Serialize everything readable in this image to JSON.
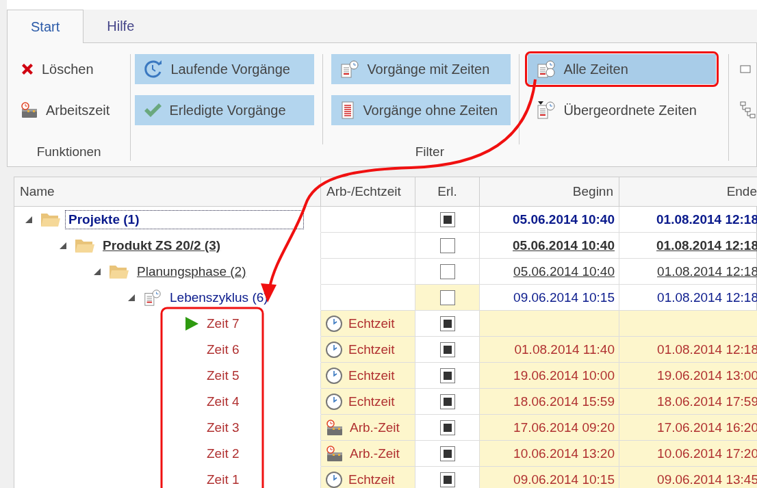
{
  "tabs": [
    {
      "label": "Start",
      "selected": true
    },
    {
      "label": "Hilfe",
      "selected": false
    }
  ],
  "ribbon": {
    "groups": [
      {
        "label": "Funktionen",
        "columns": [
          [
            {
              "label": "Löschen",
              "selected": false
            },
            {
              "label": "Arbeitszeit",
              "selected": false
            }
          ]
        ]
      },
      {
        "label": "Filter",
        "columns": [
          [
            {
              "label": "Laufende Vorgänge",
              "selected": true
            },
            {
              "label": "Erledigte Vorgänge",
              "selected": true
            }
          ],
          [
            {
              "label": "Vorgänge mit Zeiten",
              "selected": true
            },
            {
              "label": "Vorgänge ohne Zeiten",
              "selected": true
            }
          ],
          [
            {
              "label": "Alle Zeiten",
              "selected": true,
              "annotated": true
            },
            {
              "label": "Übergeordnete Zeiten",
              "selected": false
            }
          ]
        ]
      },
      {
        "columns": [
          [
            {
              "selected": false
            },
            {
              "selected": false
            }
          ]
        ]
      }
    ]
  },
  "table": {
    "columns": [
      "Name",
      "Arb-/Echtzeit",
      "Erl.",
      "Beginn",
      "Ende"
    ],
    "rows": [
      {
        "name": "Projekte (1)",
        "kind": "project",
        "expanded": true,
        "focused": true,
        "done": true,
        "begin": "05.06.2014 10:40",
        "end": "01.08.2014 12:18",
        "children": [
          {
            "name": "Produkt ZS 20/2 (3)",
            "kind": "product",
            "expanded": true,
            "focused": false,
            "done": false,
            "begin": "05.06.2014 10:40",
            "end": "01.08.2014 12:18",
            "children": [
              {
                "name": "Planungsphase (2)",
                "kind": "phase",
                "expanded": true,
                "focused": false,
                "done": false,
                "begin": "05.06.2014 10:40",
                "end": "01.08.2014 12:18",
                "children": [
                  {
                    "name": "Lebenszyklus (6)",
                    "kind": "cycle",
                    "expanded": true,
                    "focused": false,
                    "done": false,
                    "begin": "09.06.2014 10:15",
                    "end": "01.08.2014 12:18",
                    "children": [
                      {
                        "name": "Zeit 7",
                        "kind": "time",
                        "current": true,
                        "type": {
                          "kind": "real",
                          "label": "Echtzeit"
                        },
                        "done": true
                      },
                      {
                        "name": "Zeit 6",
                        "kind": "time",
                        "current": false,
                        "type": {
                          "kind": "real",
                          "label": "Echtzeit"
                        },
                        "done": true,
                        "begin": "01.08.2014 11:40",
                        "end": "01.08.2014 12:18"
                      },
                      {
                        "name": "Zeit 5",
                        "kind": "time",
                        "current": false,
                        "type": {
                          "kind": "real",
                          "label": "Echtzeit"
                        },
                        "done": true,
                        "begin": "19.06.2014 10:00",
                        "end": "19.06.2014 13:00"
                      },
                      {
                        "name": "Zeit 4",
                        "kind": "time",
                        "current": false,
                        "type": {
                          "kind": "real",
                          "label": "Echtzeit"
                        },
                        "done": true,
                        "begin": "18.06.2014 15:59",
                        "end": "18.06.2014 17:59"
                      },
                      {
                        "name": "Zeit 3",
                        "kind": "time",
                        "current": false,
                        "type": {
                          "kind": "work",
                          "label": "Arb.-Zeit"
                        },
                        "done": true,
                        "begin": "17.06.2014 09:20",
                        "end": "17.06.2014 16:20"
                      },
                      {
                        "name": "Zeit 2",
                        "kind": "time",
                        "current": false,
                        "type": {
                          "kind": "work",
                          "label": "Arb.-Zeit"
                        },
                        "done": true,
                        "begin": "10.06.2014 13:20",
                        "end": "10.06.2014 17:20"
                      },
                      {
                        "name": "Zeit 1",
                        "kind": "time",
                        "current": false,
                        "type": {
                          "kind": "real",
                          "label": "Echtzeit"
                        },
                        "done": true,
                        "begin": "09.06.2014 10:15",
                        "end": "09.06.2014 13:45"
                      }
                    ]
                  }
                ]
              }
            ]
          }
        ]
      }
    ]
  }
}
